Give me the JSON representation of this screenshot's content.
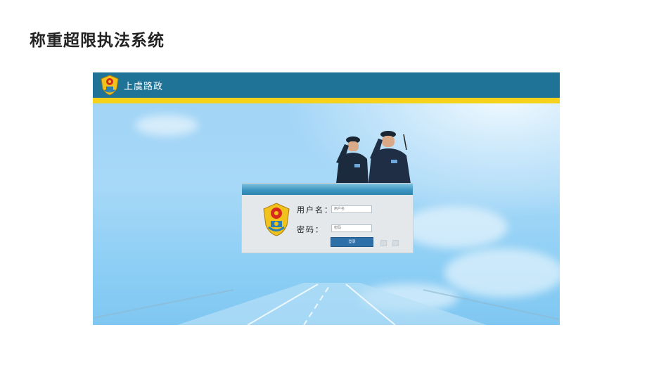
{
  "page": {
    "title": "称重超限执法系统"
  },
  "header": {
    "title": "上虞路政",
    "emblem_icon": "road-administration-emblem-icon"
  },
  "colors": {
    "header_bg": "#1e7396",
    "stripe": "#f7d21a",
    "sky": "#9fd3f6",
    "button": "#2f6fa8"
  },
  "login": {
    "username_label": "用户名：",
    "username_placeholder": "用户名",
    "password_label": "密码：",
    "password_placeholder": "密码",
    "submit_label": "登录"
  }
}
